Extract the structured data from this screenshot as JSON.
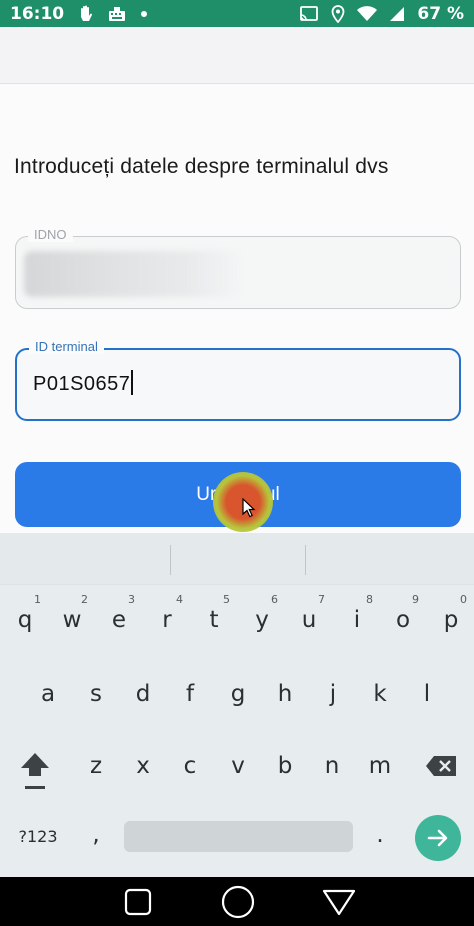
{
  "status_bar": {
    "time": "16:10",
    "battery_percent": "67 %",
    "icons": [
      "hand-icon",
      "keyboard-icon",
      "dot-icon",
      "cast-icon",
      "location-icon",
      "wifi-icon",
      "signal-icon",
      "battery-icon"
    ]
  },
  "page": {
    "title": "Introduceți datele despre terminalul dvs"
  },
  "form": {
    "idno": {
      "label": "IDNO",
      "value_obscured": true
    },
    "terminal_id": {
      "label": "ID terminal",
      "value": "P01S0657"
    },
    "submit_label": "Urmatorul"
  },
  "keyboard": {
    "row1": [
      {
        "key": "q",
        "hint": "1"
      },
      {
        "key": "w",
        "hint": "2"
      },
      {
        "key": "e",
        "hint": "3"
      },
      {
        "key": "r",
        "hint": "4"
      },
      {
        "key": "t",
        "hint": "5"
      },
      {
        "key": "y",
        "hint": "6"
      },
      {
        "key": "u",
        "hint": "7"
      },
      {
        "key": "i",
        "hint": "8"
      },
      {
        "key": "o",
        "hint": "9"
      },
      {
        "key": "p",
        "hint": "0"
      }
    ],
    "row2": [
      "a",
      "s",
      "d",
      "f",
      "g",
      "h",
      "j",
      "k",
      "l"
    ],
    "row3": [
      "z",
      "x",
      "c",
      "v",
      "b",
      "n",
      "m"
    ],
    "symbols_label": "?123",
    "comma": ",",
    "period": "."
  },
  "colors": {
    "status_bar": "#1f8f6a",
    "primary": "#2a7ae8",
    "focus_border": "#2371c9",
    "enter_key": "#3fb59a"
  }
}
